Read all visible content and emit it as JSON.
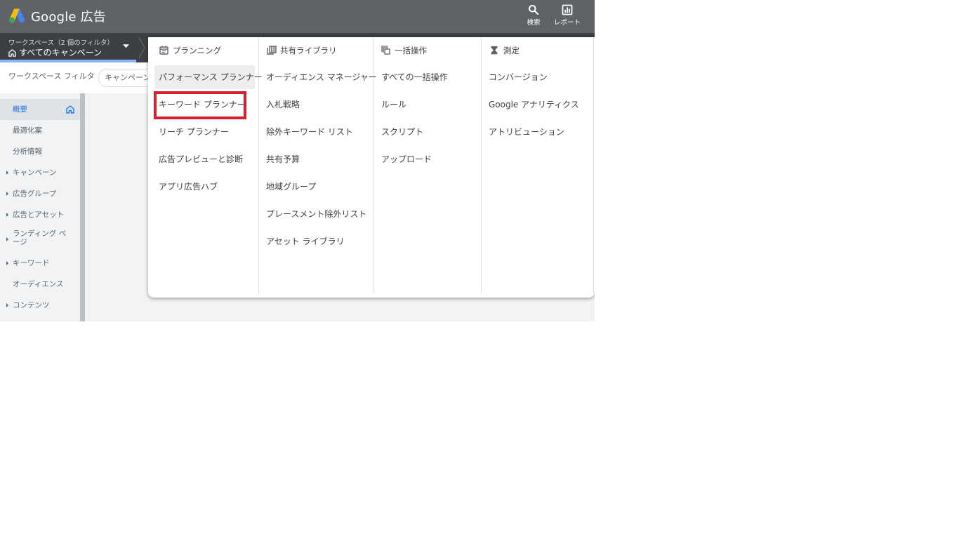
{
  "header": {
    "app_name": "Google 広告",
    "search_label": "検索",
    "reports_label": "レポート"
  },
  "workspace": {
    "filter_summary": "ワークスペース（2 個のフィルタ）",
    "selected": "すべてのキャンペーン"
  },
  "filterbar": {
    "label": "ワークスペース フィルタ",
    "chip_text": "キャンペーンの"
  },
  "sidebar": {
    "items": [
      {
        "label": "概要",
        "expandable": false
      },
      {
        "label": "最適化案",
        "expandable": false
      },
      {
        "label": "分析情報",
        "expandable": false
      },
      {
        "label": "キャンペーン",
        "expandable": true
      },
      {
        "label": "広告グループ",
        "expandable": true
      },
      {
        "label": "広告とアセット",
        "expandable": true
      },
      {
        "label": "ランディング ページ",
        "expandable": true
      },
      {
        "label": "キーワード",
        "expandable": true
      },
      {
        "label": "オーディエンス",
        "expandable": false
      },
      {
        "label": "コンテンツ",
        "expandable": true
      }
    ]
  },
  "menu": {
    "columns": [
      {
        "heading": "プランニング",
        "icon": "calendar-icon",
        "items": [
          "パフォーマンス プランナー",
          "キーワード プランナー",
          "リーチ プランナー",
          "広告プレビューと診断",
          "アプリ広告ハブ"
        ]
      },
      {
        "heading": "共有ライブラリ",
        "icon": "library-icon",
        "items": [
          "オーディエンス マネージャー",
          "入札戦略",
          "除外キーワード リスト",
          "共有予算",
          "地域グループ",
          "プレースメント除外リスト",
          "アセット ライブラリ"
        ]
      },
      {
        "heading": "一括操作",
        "icon": "bulk-copy-icon",
        "items": [
          "すべての一括操作",
          "ルール",
          "スクリプト",
          "アップロード"
        ]
      },
      {
        "heading": "測定",
        "icon": "hourglass-icon",
        "items": [
          "コンバージョン",
          "Google アナリティクス",
          "アトリビューション"
        ]
      }
    ]
  },
  "colors": {
    "header_bg": "#5f6368",
    "workspace_bar_bg": "#3c4043",
    "highlight_border": "#d4202c",
    "active_nav": "#1a73e8"
  }
}
